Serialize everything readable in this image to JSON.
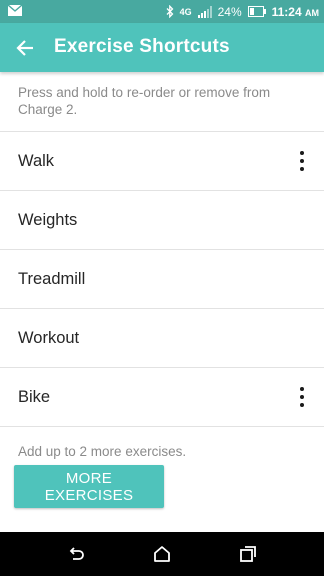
{
  "status_bar": {
    "battery": "24%",
    "time": "11:24",
    "time_suffix": "AM",
    "network": "4G"
  },
  "app_bar": {
    "title": "Exercise Shortcuts"
  },
  "hint_text": "Press and hold to re-order or remove from Charge 2.",
  "exercises": [
    {
      "label": "Walk",
      "has_menu": true
    },
    {
      "label": "Weights",
      "has_menu": false
    },
    {
      "label": "Treadmill",
      "has_menu": false
    },
    {
      "label": "Workout",
      "has_menu": false
    },
    {
      "label": "Bike",
      "has_menu": true
    }
  ],
  "add_note": "Add up to 2 more exercises.",
  "more_button": "MORE EXERCISES",
  "colors": {
    "accent": "#4fc3bb",
    "status_bar": "#48a9a0"
  }
}
